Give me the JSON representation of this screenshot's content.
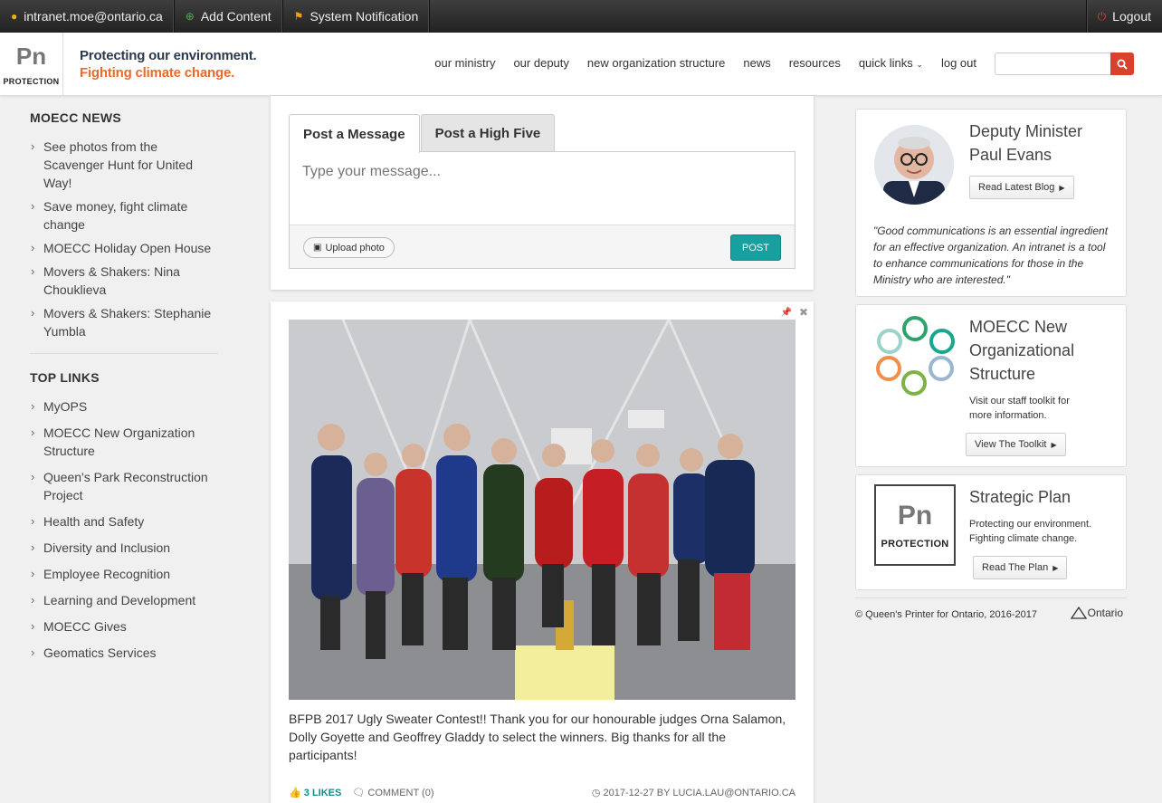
{
  "topbar": {
    "user": "intranet.moe@ontario.ca",
    "add_content": "Add Content",
    "notification": "System Notification",
    "logout": "Logout"
  },
  "header": {
    "logo_pn": "Pn",
    "logo_protection": "PROTECTION",
    "tagline_line1": "Protecting our environment.",
    "tagline_line2": "Fighting climate change.",
    "nav": [
      "our ministry",
      "our deputy",
      "new organization structure",
      "news",
      "resources",
      "quick links",
      "log out"
    ],
    "search_placeholder": ""
  },
  "sidebar": {
    "news_title": "MOECC NEWS",
    "news": [
      "See photos from the Scavenger Hunt for United Way!",
      "Save money, fight climate change",
      "MOECC Holiday Open House",
      "Movers & Shakers: Nina Chouklieva",
      "Movers & Shakers: Stephanie Yumbla"
    ],
    "links_title": "TOP LINKS",
    "links": [
      "MyOPS",
      "MOECC New Organization Structure",
      "Queen's Park Reconstruction Project",
      "Health and Safety",
      "Diversity and Inclusion",
      "Employee Recognition",
      "Learning and Development",
      "MOECC Gives",
      "Geomatics Services"
    ]
  },
  "composer": {
    "tab_message": "Post a Message",
    "tab_highfive": "Post a High Five",
    "placeholder": "Type your message...",
    "upload": "Upload photo",
    "post": "POST"
  },
  "post": {
    "caption": "BFPB 2017 Ugly Sweater Contest!! Thank you for our honourable judges Orna Salamon, Dolly Goyette and Geoffrey Gladdy to select the winners. Big thanks for all the participants!",
    "likes": "3 LIKES",
    "comment": "COMMENT (0)",
    "date_author": "2017-12-27 BY LUCIA.LAU@ONTARIO.CA"
  },
  "cards": {
    "deputy": {
      "title": "Deputy Minister Paul Evans",
      "button": "Read Latest Blog",
      "quote": "\"Good communications is an essential ingredient for an effective organization. An intranet is a tool to enhance communications for those in the Ministry who are interested.\""
    },
    "structure": {
      "title": "MOECC New Organizational Structure",
      "text": "Visit our staff toolkit for more information.",
      "button": "View The Toolkit"
    },
    "plan": {
      "title": "Strategic Plan",
      "text": "Protecting our environment. Fighting climate change.",
      "button": "Read The Plan",
      "logo_pn": "Pn",
      "logo_protection": "PROTECTION"
    }
  },
  "footer": {
    "copyright": "© Queen's Printer for Ontario, 2016-2017",
    "ontario": "Ontario"
  },
  "colors": {
    "accent_teal": "#17a0a0",
    "brand_orange": "#e96a2b",
    "search_red": "#d9402d"
  }
}
